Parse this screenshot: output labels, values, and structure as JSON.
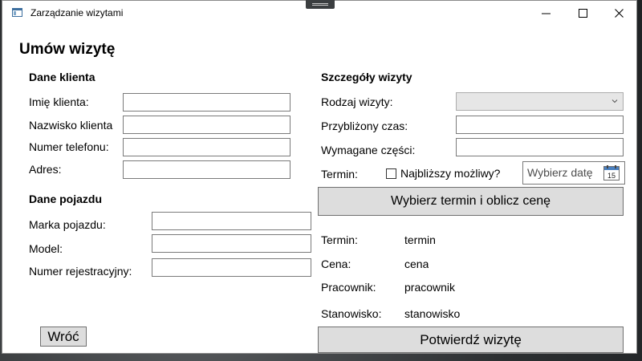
{
  "window": {
    "title": "Zarządzanie wizytami"
  },
  "page": {
    "title": "Umów wizytę"
  },
  "client": {
    "heading": "Dane klienta",
    "fields": [
      {
        "label": "Imię klienta:",
        "value": ""
      },
      {
        "label": "Nazwisko klienta",
        "value": ""
      },
      {
        "label": "Numer telefonu:",
        "value": ""
      },
      {
        "label": "Adres:",
        "value": ""
      }
    ]
  },
  "vehicle": {
    "heading": "Dane pojazdu",
    "fields": [
      {
        "label": "Marka pojazdu:",
        "value": ""
      },
      {
        "label": "Model:",
        "value": ""
      },
      {
        "label": "Numer rejestracyjny:",
        "value": ""
      }
    ]
  },
  "visit": {
    "heading": "Szczegóły wizyty",
    "type_label": "Rodzaj wizyty:",
    "type_value": "",
    "time_label": "Przybliżony czas:",
    "parts_label": "Wymagane części:",
    "term_label": "Termin:",
    "nearest_label": "Najbliższy możliwy?",
    "nearest_checked": false,
    "date_placeholder": "Wybierz datę",
    "calendar_day": "15",
    "calc_button": "Wybierz termin i oblicz cenę"
  },
  "summary": {
    "rows": [
      {
        "label": "Termin:",
        "value": "termin"
      },
      {
        "label": "Cena:",
        "value": "cena"
      },
      {
        "label": "Pracownik:",
        "value": "pracownik"
      },
      {
        "label": "Stanowisko:",
        "value": "stanowisko"
      }
    ]
  },
  "actions": {
    "back": "Wróć",
    "confirm": "Potwierdź wizytę"
  }
}
